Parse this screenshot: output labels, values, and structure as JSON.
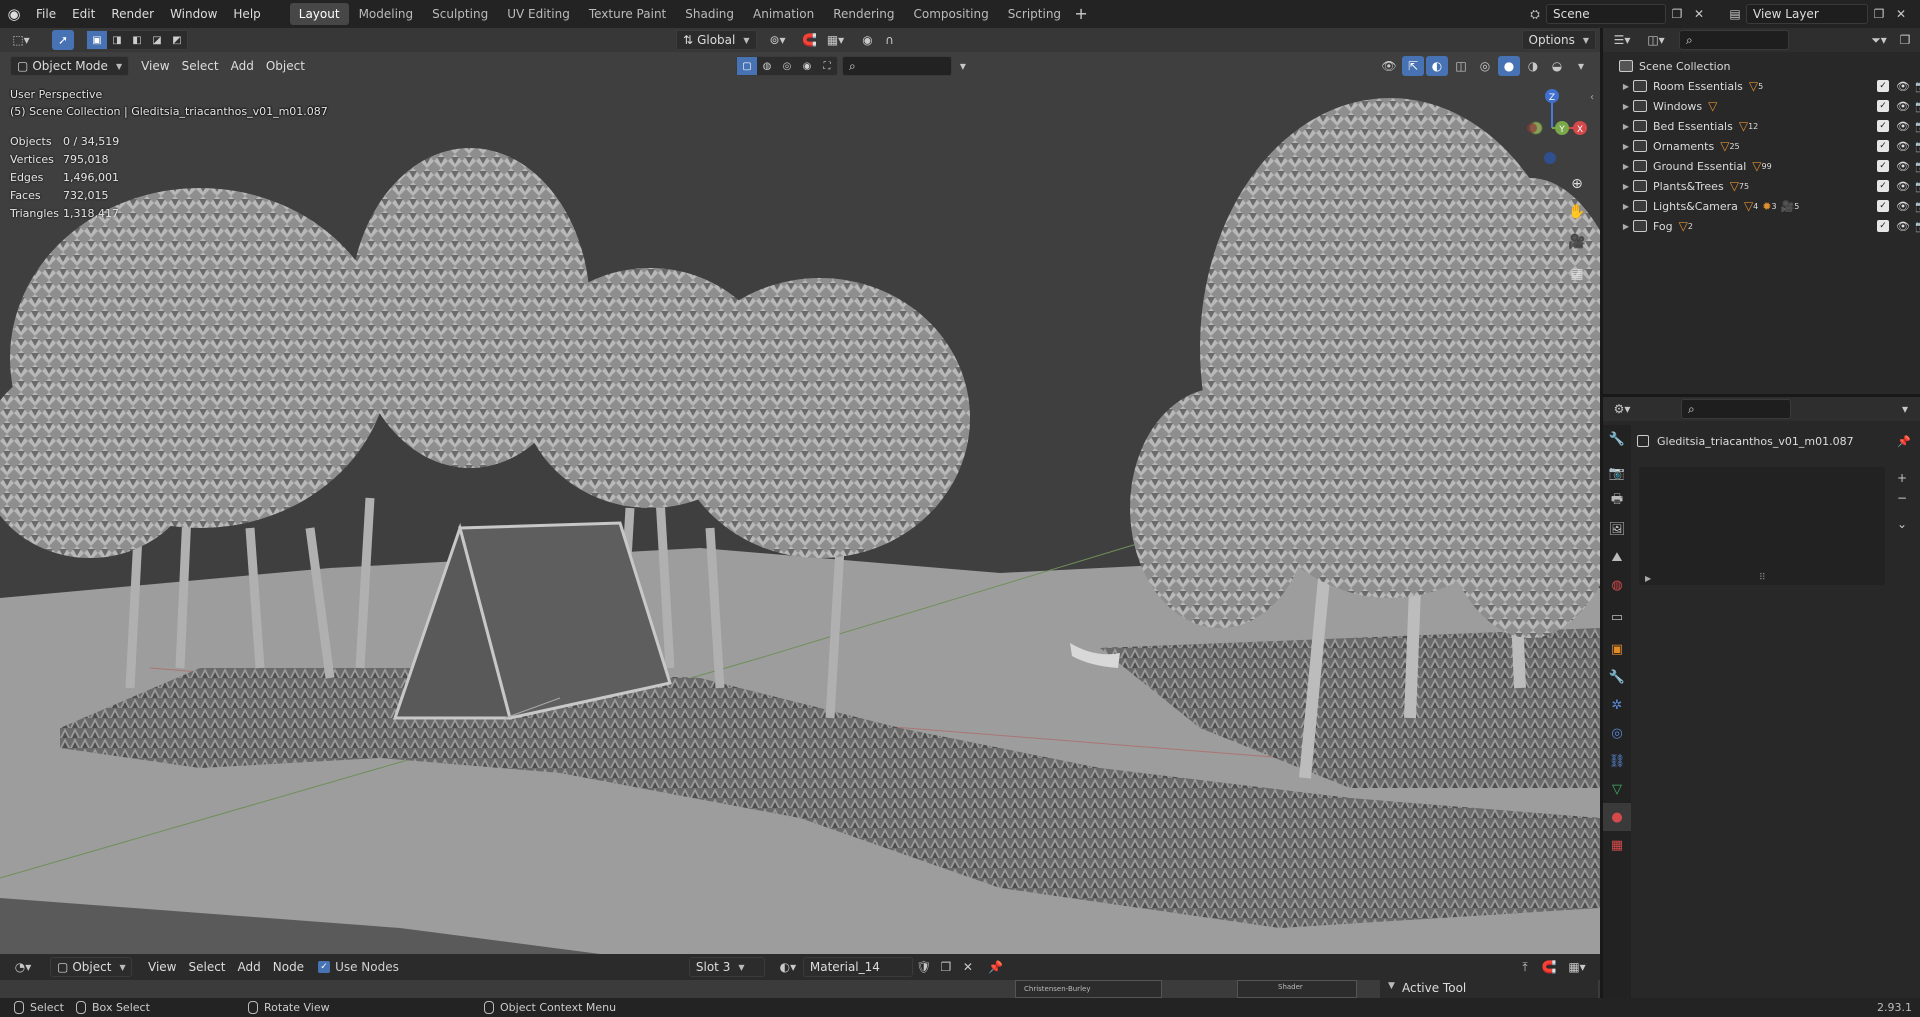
{
  "topbar": {
    "menus": [
      "File",
      "Edit",
      "Render",
      "Window",
      "Help"
    ],
    "tabs": [
      "Layout",
      "Modeling",
      "Sculpting",
      "UV Editing",
      "Texture Paint",
      "Shading",
      "Animation",
      "Rendering",
      "Compositing",
      "Scripting"
    ],
    "active_tab": "Layout",
    "scene_name": "Scene",
    "view_layer_name": "View Layer"
  },
  "viewport": {
    "mode": "Object Mode",
    "menus": [
      "View",
      "Select",
      "Add",
      "Object"
    ],
    "orientation": "Global",
    "options_label": "Options",
    "perspective_label": "User Perspective",
    "collection_label": "(5) Scene Collection | Gleditsia_triacanthos_v01_m01.087",
    "stats": [
      {
        "label": "Objects",
        "value": "0 / 34,519"
      },
      {
        "label": "Vertices",
        "value": "795,018"
      },
      {
        "label": "Edges",
        "value": "1,496,001"
      },
      {
        "label": "Faces",
        "value": "732,015"
      },
      {
        "label": "Triangles",
        "value": "1,318,417"
      }
    ],
    "gizmo": {
      "x": "X",
      "y": "Y",
      "z": "Z"
    }
  },
  "outliner": {
    "root": "Scene Collection",
    "collections": [
      {
        "name": "Room Essentials",
        "count": "5"
      },
      {
        "name": "Windows",
        "count": ""
      },
      {
        "name": "Bed Essentials",
        "count": "12"
      },
      {
        "name": "Ornaments",
        "count": "25"
      },
      {
        "name": "Ground Essential",
        "count": "99"
      },
      {
        "name": "Plants&Trees",
        "count": "75"
      },
      {
        "name": "Lights&Camera",
        "count": "4"
      },
      {
        "name": "Fog",
        "count": "2"
      }
    ],
    "lights_extra": [
      "3",
      "5"
    ]
  },
  "properties": {
    "object_name": "Gleditsia_triacanthos_v01_m01.087",
    "tabs": [
      "tool",
      "render",
      "output",
      "view-layer",
      "scene",
      "world",
      "collection",
      "object",
      "modifiers",
      "particles",
      "physics",
      "constraints",
      "data",
      "material",
      "texture"
    ],
    "active_tab": "material",
    "tab_colors": [
      "#bbbbbb",
      "#bbbbbb",
      "#bbbbbb",
      "#bbbbbb",
      "#bbbbbb",
      "#d44a4a",
      "#bbbbbb",
      "#e08a2a",
      "#5a8ad6",
      "#5a8ad6",
      "#5a8ad6",
      "#5a8ad6",
      "#3fb36a",
      "#d44a4a",
      "#d44a4a"
    ]
  },
  "node_editor": {
    "type": "Object",
    "menus": [
      "View",
      "Select",
      "Add",
      "Node"
    ],
    "use_nodes_label": "Use Nodes",
    "slot": "Slot 3",
    "material": "Material_14",
    "active_tool_label": "Active Tool",
    "node_labels": [
      "Christensen-Burley",
      "Shader"
    ]
  },
  "statusbar": {
    "select": "Select",
    "box_select": "Box Select",
    "rotate_view": "Rotate View",
    "context_menu": "Object Context Menu",
    "version": "2.93.1"
  }
}
